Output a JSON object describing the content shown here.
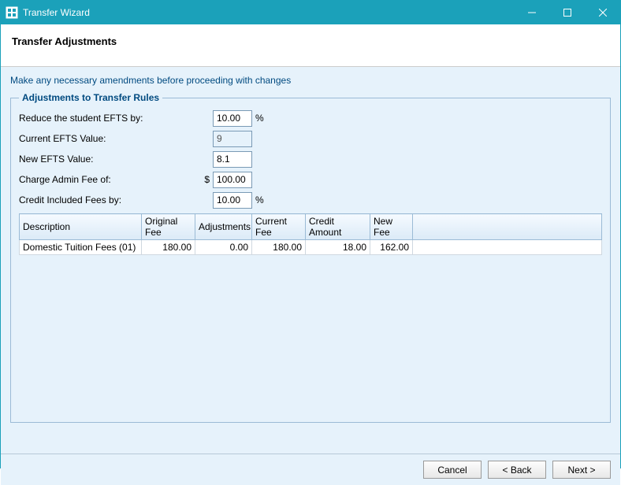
{
  "window": {
    "title": "Transfer Wizard"
  },
  "header": {
    "title": "Transfer Adjustments"
  },
  "intro": "Make any necessary amendments before proceeding with changes",
  "group": {
    "legend": "Adjustments to Transfer Rules",
    "reduce_efts_label": "Reduce the student EFTS by:",
    "reduce_efts_value": "10.00",
    "reduce_efts_suffix": "%",
    "current_efts_label": "Current EFTS Value:",
    "current_efts_value": "9",
    "new_efts_label": "New EFTS Value:",
    "new_efts_value": "8.1",
    "admin_fee_label": "Charge Admin Fee of:",
    "admin_fee_prefix": "$",
    "admin_fee_value": "100.00",
    "credit_fees_label": "Credit Included Fees by:",
    "credit_fees_value": "10.00",
    "credit_fees_suffix": "%"
  },
  "table": {
    "headers": {
      "description": "Description",
      "original": "Original Fee",
      "adjustments": "Adjustments",
      "current": "Current Fee",
      "credit": "Credit Amount",
      "newfee": "New Fee"
    },
    "rows": [
      {
        "description": "Domestic Tuition Fees (01)",
        "original": "180.00",
        "adjustments": "0.00",
        "current": "180.00",
        "credit": "18.00",
        "newfee": "162.00"
      }
    ]
  },
  "footer": {
    "cancel": "Cancel",
    "back": "< Back",
    "next": "Next >"
  }
}
